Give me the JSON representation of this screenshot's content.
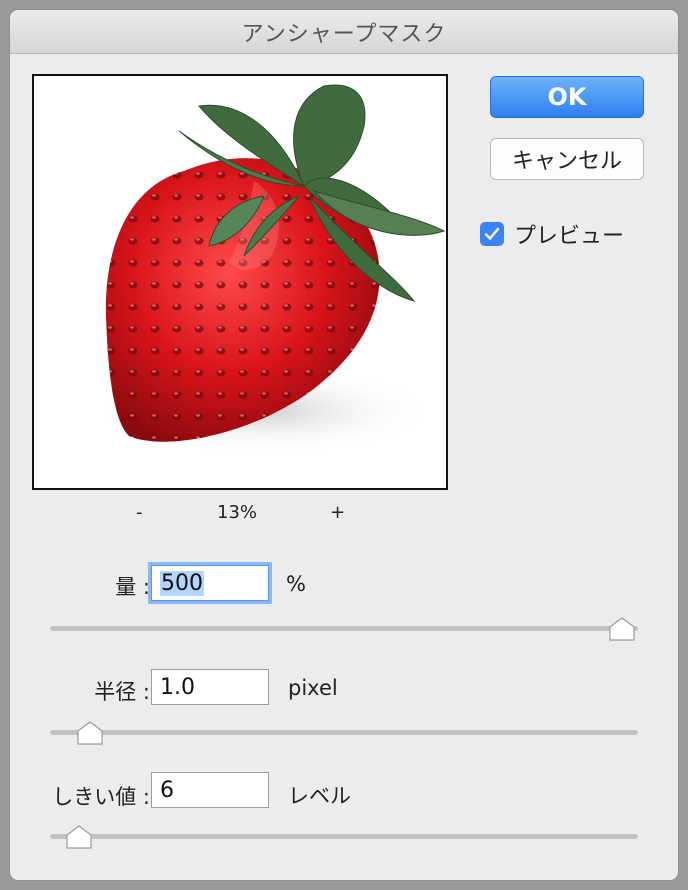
{
  "window": {
    "title": "アンシャープマスク"
  },
  "buttons": {
    "ok_label": "OK",
    "cancel_label": "キャンセル"
  },
  "preview": {
    "label": "プレビュー",
    "checked": true
  },
  "zoom": {
    "minus": "-",
    "level": "13%",
    "plus": "+"
  },
  "fields": {
    "amount": {
      "label": "量 :",
      "value": "500",
      "unit": "%",
      "slider_fraction": 1.0
    },
    "radius": {
      "label": "半径 :",
      "value": "1.0",
      "unit": "pixel",
      "slider_fraction": 0.05
    },
    "threshold": {
      "label": "しきい値 :",
      "value": "6",
      "unit": "レベル",
      "slider_fraction": 0.03
    }
  },
  "colors": {
    "accent": "#3a82f7",
    "ok_button": "#2f7ff0",
    "strawberry": "#d8141a",
    "leaf": "#3f6b3e"
  }
}
